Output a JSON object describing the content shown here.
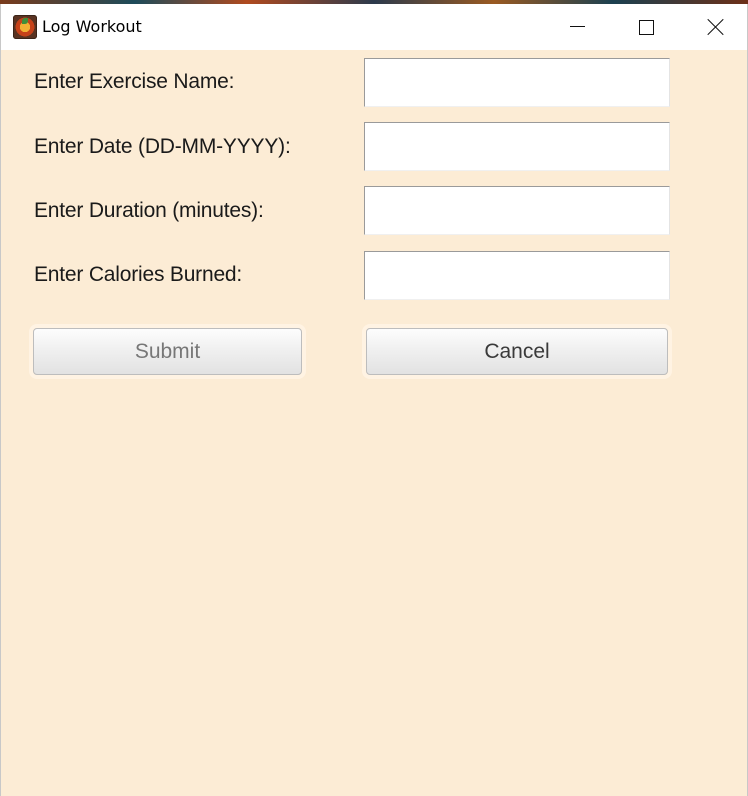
{
  "window": {
    "title": "Log Workout",
    "controls": {
      "minimize_icon": "minimize-icon",
      "maximize_icon": "maximize-icon",
      "close_icon": "close-icon"
    }
  },
  "form": {
    "fields": [
      {
        "label": "Enter Exercise Name:",
        "value": ""
      },
      {
        "label": "Enter Date (DD-MM-YYYY):",
        "value": ""
      },
      {
        "label": "Enter Duration (minutes):",
        "value": ""
      },
      {
        "label": "Enter Calories Burned:",
        "value": ""
      }
    ],
    "submit_label": "Submit",
    "cancel_label": "Cancel"
  },
  "colors": {
    "background": "#fcecd5",
    "titlebar": "#ffffff",
    "input_bg": "#ffffff"
  }
}
